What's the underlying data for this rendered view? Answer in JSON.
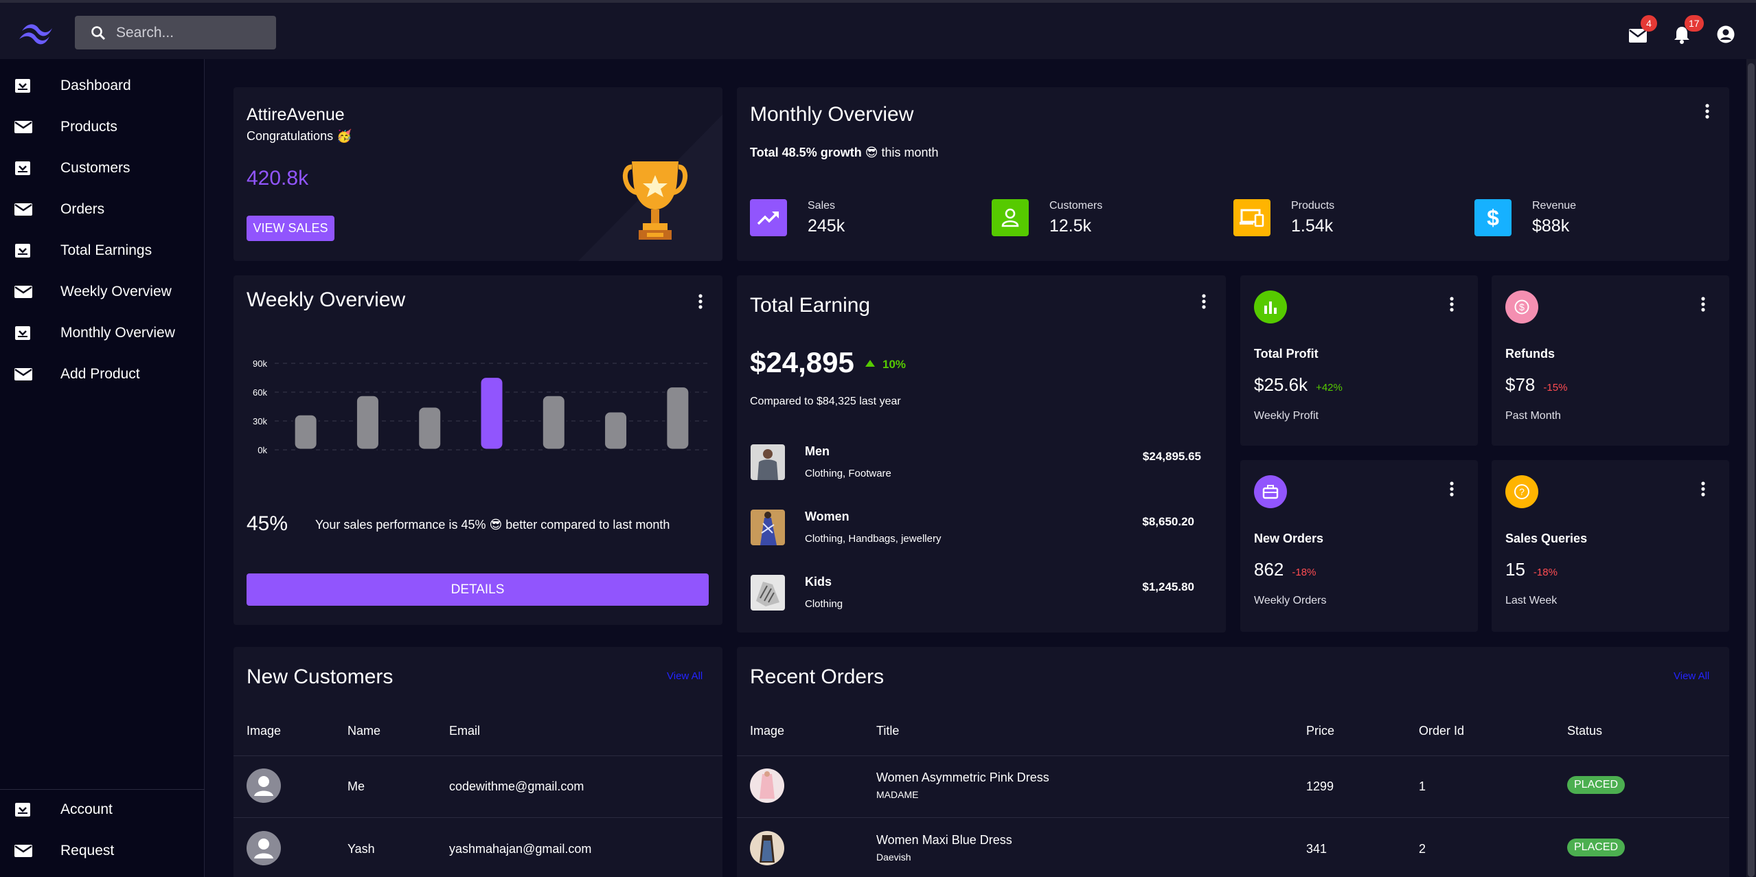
{
  "search": {
    "placeholder": "Search..."
  },
  "header": {
    "mail_badge": "4",
    "notif_badge": "17"
  },
  "sidebar": {
    "items": [
      {
        "label": "Dashboard",
        "icon": "inbox-icon"
      },
      {
        "label": "Products",
        "icon": "mail-icon"
      },
      {
        "label": "Customers",
        "icon": "inbox-icon"
      },
      {
        "label": "Orders",
        "icon": "mail-icon"
      },
      {
        "label": "Total Earnings",
        "icon": "inbox-icon"
      },
      {
        "label": "Weekly Overview",
        "icon": "mail-icon"
      },
      {
        "label": "Monthly Overview",
        "icon": "inbox-icon"
      },
      {
        "label": "Add Product",
        "icon": "mail-icon"
      }
    ],
    "bottom_items": [
      {
        "label": "Account",
        "icon": "inbox-icon"
      },
      {
        "label": "Request",
        "icon": "mail-icon"
      }
    ]
  },
  "welcome": {
    "brand": "AttireAvenue",
    "congrats": "Congratulations 🥳",
    "amount": "420.8k",
    "button": "VIEW SALES"
  },
  "monthly": {
    "title": "Monthly Overview",
    "growth_bold": "Total 48.5% growth",
    "growth_rest": "😎 this month",
    "stats": [
      {
        "label": "Sales",
        "value": "245k",
        "color": "#9155fd",
        "icon": "trending-up-icon"
      },
      {
        "label": "Customers",
        "value": "12.5k",
        "color": "#56ca00",
        "icon": "user-icon"
      },
      {
        "label": "Products",
        "value": "1.54k",
        "color": "#ffb400",
        "icon": "devices-icon"
      },
      {
        "label": "Revenue",
        "value": "$88k",
        "color": "#16b1ff",
        "icon": "dollar-icon"
      }
    ]
  },
  "weekly": {
    "title": "Weekly Overview",
    "percent": "45%",
    "message": "Your sales performance is 45% 😎 better compared to last month",
    "button": "DETAILS"
  },
  "chart_data": {
    "type": "bar",
    "categories": [
      "",
      "",
      "",
      "",
      "",
      "",
      ""
    ],
    "values": [
      37,
      57,
      45,
      76,
      57,
      40,
      66
    ],
    "highlight_index": 3,
    "y_ticks": [
      "90k",
      "60k",
      "30k",
      "0k"
    ],
    "ylim": [
      0,
      90
    ],
    "colors": {
      "bar": "#8a8a8f",
      "highlight": "#9155fd"
    },
    "grid": true
  },
  "earning": {
    "title": "Total Earning",
    "amount": "$24,895",
    "delta": "10%",
    "compare": "Compared to $84,325 last year",
    "rows": [
      {
        "name": "Men",
        "sub": "Clothing, Footware",
        "amount": "$24,895.65"
      },
      {
        "name": "Women",
        "sub": "Clothing, Handbags, jewellery",
        "amount": "$8,650.20"
      },
      {
        "name": "Kids",
        "sub": "Clothing",
        "amount": "$1,245.80"
      }
    ]
  },
  "minis": [
    {
      "title": "Total Profit",
      "value": "$25.6k",
      "delta": "+42%",
      "delta_color": "#56ca00",
      "sub": "Weekly Profit",
      "color": "#56ca00",
      "icon": "bar-chart-icon"
    },
    {
      "title": "Refunds",
      "value": "$78",
      "delta": "-15%",
      "delta_color": "#ff4c51",
      "sub": "Past Month",
      "color": "#f48fb1",
      "icon": "dollar-icon"
    },
    {
      "title": "New Orders",
      "value": "862",
      "delta": "-18%",
      "delta_color": "#ff4c51",
      "sub": "Weekly Orders",
      "color": "#9155fd",
      "icon": "briefcase-icon"
    },
    {
      "title": "Sales Queries",
      "value": "15",
      "delta": "-18%",
      "delta_color": "#ff4c51",
      "sub": "Last Week",
      "color": "#ffb400",
      "icon": "help-icon"
    }
  ],
  "customers": {
    "title": "New Customers",
    "view_all": "View All",
    "columns": [
      "Image",
      "Name",
      "Email"
    ],
    "rows": [
      {
        "name": "Me",
        "email": "codewithme@gmail.com"
      },
      {
        "name": "Yash",
        "email": "yashmahajan@gmail.com"
      }
    ]
  },
  "orders": {
    "title": "Recent Orders",
    "view_all": "View All",
    "columns": [
      "Image",
      "Title",
      "Price",
      "Order Id",
      "Status"
    ],
    "rows": [
      {
        "title": "Women Asymmetric Pink Dress",
        "brand": "MADAME",
        "price": "1299",
        "id": "1",
        "status": "PLACED"
      },
      {
        "title": "Women Maxi Blue Dress",
        "brand": "Daevish",
        "price": "341",
        "id": "2",
        "status": "PLACED"
      }
    ]
  }
}
